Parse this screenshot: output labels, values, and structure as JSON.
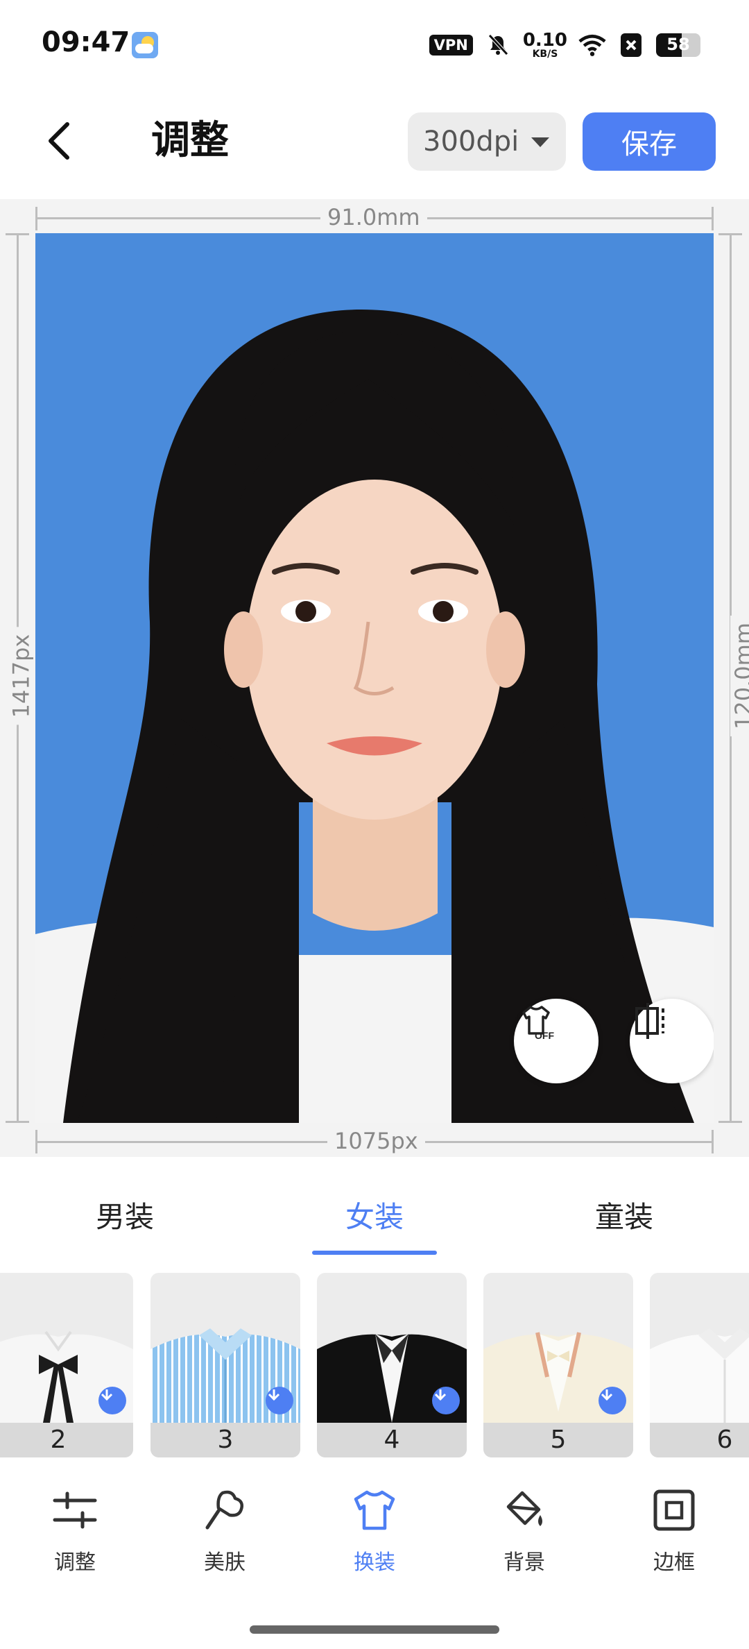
{
  "status_bar": {
    "time": "09:47",
    "vpn": "VPN",
    "net_speed_value": "0.10",
    "net_speed_unit": "KB/S",
    "battery_level": "58",
    "battery_fraction": 0.58
  },
  "header": {
    "title": "调整",
    "dpi_value": "300dpi",
    "save_label": "保存"
  },
  "canvas": {
    "width_mm": "91.0mm",
    "height_mm": "120.0mm",
    "width_px": "1075px",
    "height_px": "1417px",
    "background_color": "#4a8bdb"
  },
  "category_tabs": [
    {
      "label": "男装",
      "active": false
    },
    {
      "label": "女装",
      "active": true
    },
    {
      "label": "童装",
      "active": false
    }
  ],
  "outfits": [
    {
      "number": "2",
      "style": "white-shirt-black-bow"
    },
    {
      "number": "3",
      "style": "blue-striped-shirt"
    },
    {
      "number": "4",
      "style": "black-suit-white-shirt"
    },
    {
      "number": "5",
      "style": "cream-blazer-bow"
    },
    {
      "number": "6",
      "style": "white-shirt"
    }
  ],
  "bottom_nav": [
    {
      "label": "调整",
      "icon": "sliders-icon",
      "active": false
    },
    {
      "label": "美肤",
      "icon": "beauty-brush-icon",
      "active": false
    },
    {
      "label": "换装",
      "icon": "tshirt-icon",
      "active": true
    },
    {
      "label": "背景",
      "icon": "paint-bucket-icon",
      "active": false
    },
    {
      "label": "边框",
      "icon": "frame-icon",
      "active": false
    }
  ],
  "colors": {
    "accent": "#4e7ff3",
    "photo_background": "#4a8bdb"
  }
}
